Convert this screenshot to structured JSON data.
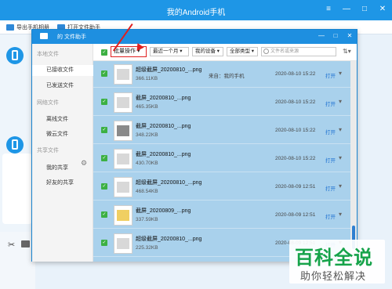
{
  "app": {
    "title": "我的Android手机",
    "toolbar": [
      "导出手机相册",
      "打开文件助手"
    ]
  },
  "dialog": {
    "title": "的 文件助手"
  },
  "sidebar": {
    "groups": [
      {
        "label": "本地文件",
        "items": [
          "已接收文件",
          "已发送文件"
        ]
      },
      {
        "label": "网络文件",
        "items": [
          "离线文件",
          "微云文件"
        ]
      },
      {
        "label": "共享文件",
        "items": [
          "我的共享",
          "好友的共享"
        ]
      }
    ],
    "active": "已接收文件"
  },
  "filters": {
    "batch": "批量操作",
    "time": "最近一个月",
    "device": "我的设备",
    "type": "全部类型",
    "search_placeholder": "文件名或来源"
  },
  "files": [
    {
      "name": "超级截屏_20200810_...png",
      "size": "366.11KB",
      "from": "来自：我的手机",
      "date": "2020-08-10 15:22",
      "action": "打开"
    },
    {
      "name": "截屏_20200810_...png",
      "size": "465.35KB",
      "from": "",
      "date": "2020-08-10 15:22",
      "action": "打开"
    },
    {
      "name": "截屏_20200810_...png",
      "size": "348.22KB",
      "from": "",
      "date": "2020-08-10 15:22",
      "action": "打开"
    },
    {
      "name": "截屏_20200810_...png",
      "size": "430.70KB",
      "from": "",
      "date": "2020-08-10 15:22",
      "action": "打开"
    },
    {
      "name": "超级截屏_20200810_...png",
      "size": "468.54KB",
      "from": "",
      "date": "2020-08-09 12:51",
      "action": "打开"
    },
    {
      "name": "截屏_20200809_...png",
      "size": "337.59KB",
      "from": "",
      "date": "2020-08-09 12:51",
      "action": "打开"
    },
    {
      "name": "超级截屏_20200810_...png",
      "size": "225.32KB",
      "from": "",
      "date": "2020-08-09 12:51",
      "action": "打开"
    }
  ],
  "watermark": {
    "big": "百科全说",
    "small": "助你轻松解决"
  }
}
